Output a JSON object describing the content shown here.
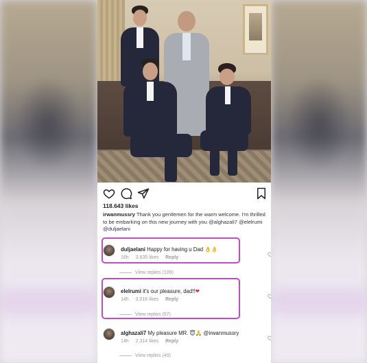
{
  "post": {
    "likes": "118.643 likes",
    "caption_user": "irwanmussry",
    "caption_text": " Thank you gentlemen for the warm welcome. I'm thrilled to be embarking on this new journey with you ",
    "caption_tags": "@alghazali7 @elelrumi @duljaelani"
  },
  "action_icons": [
    "heart-icon",
    "comment-icon",
    "share-icon",
    "bookmark-icon"
  ],
  "comments": [
    {
      "user": "duljaelani",
      "text": " Happy for having u Dad ",
      "emoji": "👌👌",
      "time": "16h",
      "likes": "3.635 likes",
      "reply": "Reply",
      "view_replies": "View replies (109)"
    },
    {
      "user": "elelrumi",
      "text": " it's our pleasure, dad!!",
      "emoji": "❤",
      "time": "14h",
      "likes": "3.016 likes",
      "reply": "Reply",
      "view_replies": "View replies (57)"
    },
    {
      "user": "alghazali7",
      "text": " My pleasure MR. ",
      "emoji": "😇🙏",
      "tag": " @irwanmussry",
      "time": "14h",
      "likes": "2.314 likes",
      "reply": "Reply",
      "view_replies": "View replies (49)"
    }
  ],
  "colors": {
    "highlight": "#c04ac8",
    "heart_red": "#e0245e"
  }
}
